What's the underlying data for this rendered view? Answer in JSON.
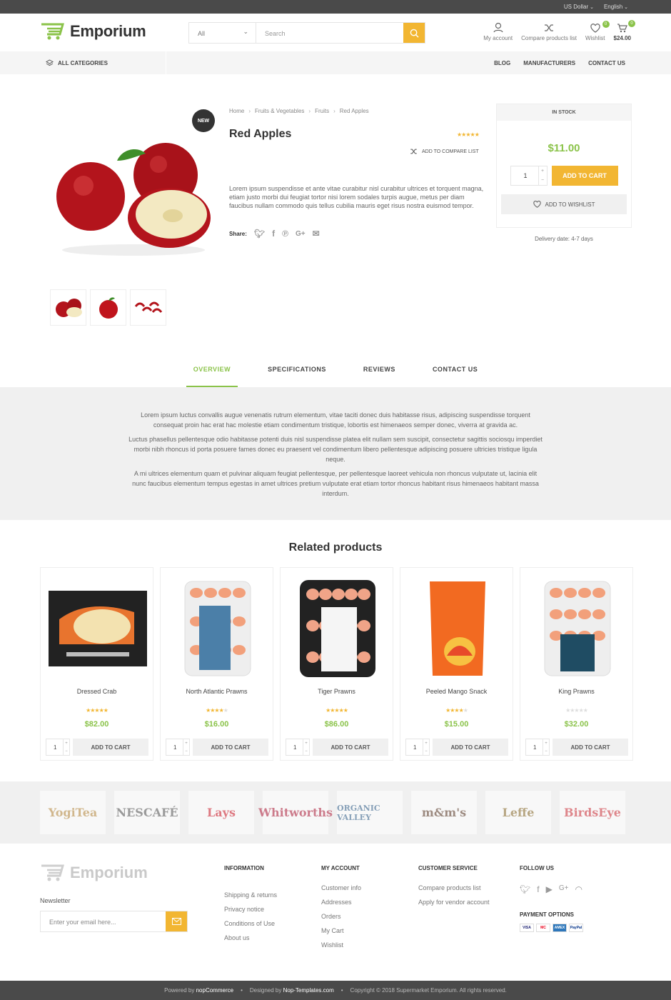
{
  "topbar": {
    "currency": "US Dollar",
    "language": "English"
  },
  "header": {
    "logo_text": "Emporium",
    "search_category": "All",
    "search_placeholder": "Search",
    "my_account": "My account",
    "compare": "Compare products list",
    "wishlist": "Wishlist",
    "wishlist_count": "0",
    "cart_count": "0",
    "cart_total": "$24.00"
  },
  "nav": {
    "all_categories": "ALL CATEGORIES",
    "links": [
      "BLOG",
      "MANUFACTURERS",
      "CONTACT US"
    ]
  },
  "product": {
    "badge": "NEW",
    "breadcrumb": [
      "Home",
      "Fruits & Vegetables",
      "Fruits",
      "Red Apples"
    ],
    "title": "Red Apples",
    "rating": 5,
    "compare_label": "ADD TO COMPARE LIST",
    "description": "Lorem ipsum suspendisse et ante vitae curabitur nisl curabitur ultrices et torquent magna, etiam justo morbi dui feugiat tortor nisi lorem sodales turpis augue, metus per diam faucibus nullam commodo quis tellus cubilia mauris eget risus nostra euismod tempor.",
    "share_label": "Share:",
    "stock": "IN STOCK",
    "price": "$11.00",
    "qty": "1",
    "add_to_cart": "ADD TO CART",
    "add_to_wishlist": "ADD TO WISHLIST",
    "delivery": "Delivery date: 4-7 days"
  },
  "tabs": [
    "OVERVIEW",
    "SPECIFICATIONS",
    "REVIEWS",
    "CONTACT US"
  ],
  "overview": [
    "Lorem ipsum luctus convallis augue venenatis rutrum elementum, vitae taciti donec duis habitasse risus, adipiscing suspendisse torquent consequat proin hac erat hac molestie etiam condimentum tristique, lobortis est himenaeos semper donec, viverra at gravida ac.",
    "Luctus phasellus pellentesque odio habitasse potenti duis nisl suspendisse platea elit nullam sem suscipit, consectetur sagittis sociosqu imperdiet morbi nibh rhoncus id porta posuere fames donec eu praesent vel condimentum libero pellentesque adipiscing posuere ultricies tristique ligula neque.",
    "A mi ultrices elementum quam et pulvinar aliquam feugiat pellentesque, per pellentesque laoreet vehicula non rhoncus vulputate ut, lacinia elit nunc faucibus elementum tempus egestas in amet ultrices pretium vulputate erat etiam tortor rhoncus habitant risus himenaeos habitant massa interdum."
  ],
  "related": {
    "title": "Related products",
    "items": [
      {
        "name": "Dressed Crab",
        "price": "$82.00",
        "rating": 5,
        "qty": "1",
        "cta": "ADD TO CART"
      },
      {
        "name": "North Atlantic Prawns",
        "price": "$16.00",
        "rating": 4,
        "qty": "1",
        "cta": "ADD TO CART"
      },
      {
        "name": "Tiger Prawns",
        "price": "$86.00",
        "rating": 5,
        "qty": "1",
        "cta": "ADD TO CART"
      },
      {
        "name": "Peeled Mango Snack",
        "price": "$15.00",
        "rating": 4,
        "qty": "1",
        "cta": "ADD TO CART"
      },
      {
        "name": "King Prawns",
        "price": "$32.00",
        "rating": 0,
        "qty": "1",
        "cta": "ADD TO CART"
      }
    ]
  },
  "brands": [
    "YogiTea",
    "NESCAFÉ",
    "Lays",
    "Whitworths",
    "ORGANIC VALLEY",
    "m&m's",
    "Leffe",
    "BirdsEye"
  ],
  "footer": {
    "logo_text": "Emporium",
    "newsletter_label": "Newsletter",
    "newsletter_placeholder": "Enter your email here...",
    "information": {
      "title": "INFORMATION",
      "links": [
        "Shipping & returns",
        "Privacy notice",
        "Conditions of Use",
        "About us"
      ]
    },
    "my_account": {
      "title": "MY ACCOUNT",
      "links": [
        "Customer info",
        "Addresses",
        "Orders",
        "My Cart",
        "Wishlist"
      ]
    },
    "customer_service": {
      "title": "CUSTOMER SERVICE",
      "links": [
        "Compare products list",
        "Apply for vendor account"
      ]
    },
    "follow_title": "FOLLOW US",
    "payment_title": "PAYMENT OPTIONS",
    "payments": [
      "VISA",
      "MC",
      "AMEX",
      "PayPal"
    ]
  },
  "bottom": {
    "powered_prefix": "Powered by",
    "powered": "nopCommerce",
    "designed_prefix": "Designed by",
    "designed": "Nop-Templates.com",
    "copyright": "Copyright © 2018 Supermarket Emporium. All rights reserved."
  },
  "colors": {
    "accent": "#8bc34a",
    "button": "#f2b632",
    "dark": "#4a4a4a"
  }
}
